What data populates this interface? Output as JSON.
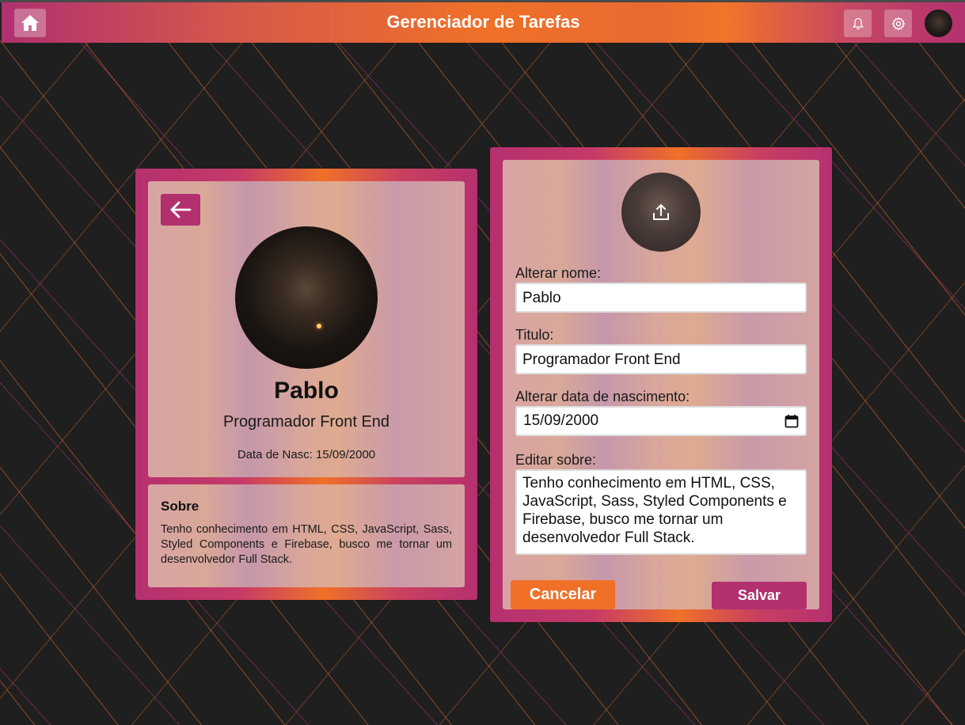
{
  "header": {
    "title": "Gerenciador de Tarefas",
    "icons": [
      "home-icon",
      "bell-icon",
      "gear-icon",
      "avatar"
    ]
  },
  "profile": {
    "name": "Pablo",
    "title": "Programador Front End",
    "dob": "Data de Nasc: 15/09/2000",
    "about_heading": "Sobre",
    "about_text": "Tenho conhecimento em HTML, CSS, JavaScript, Sass, Styled Components e Firebase, busco me tornar um desenvolvedor Full Stack."
  },
  "form": {
    "name_label": "Alterar nome:",
    "name_value": "Pablo",
    "title_label": "Titulo:",
    "title_value": "Programador Front End",
    "dob_label": "Alterar data de nascimento:",
    "dob_value": "15/09/2000",
    "about_label": "Editar sobre:",
    "about_value": "Tenho conhecimento em HTML, CSS, JavaScript, Sass, Styled Components e Firebase, busco me tornar um desenvolvedor Full Stack.",
    "cancel_label": "Cancelar",
    "save_label": "Salvar"
  },
  "colors": {
    "brand_magenta": "#b3306f",
    "brand_orange": "#f07028",
    "background": "#1f1f1f"
  }
}
